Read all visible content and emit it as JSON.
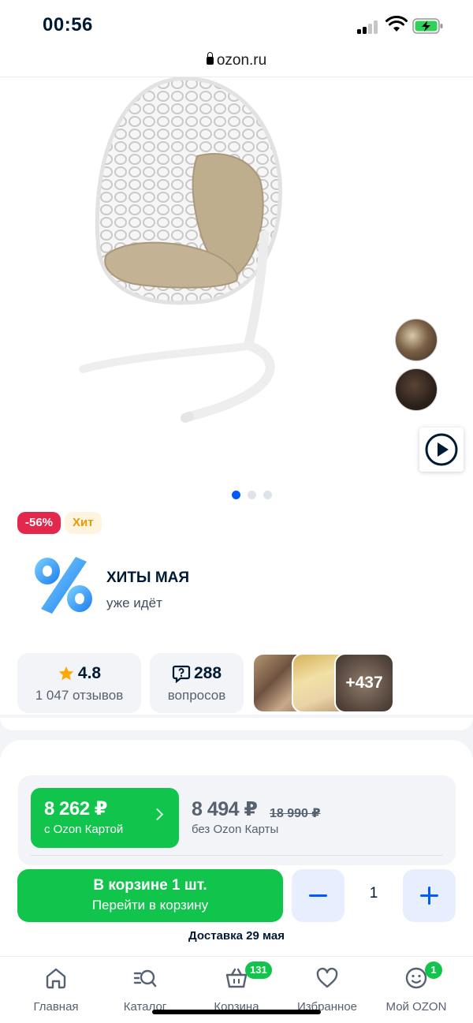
{
  "status_bar": {
    "time": "00:56"
  },
  "browser": {
    "url": "ozon.ru"
  },
  "gallery": {
    "dots_count": 3,
    "active_dot": 0
  },
  "badges": {
    "discount": "-56%",
    "hit": "Хит"
  },
  "promo": {
    "title": "ХИТЫ МАЯ",
    "subtitle": "уже идёт"
  },
  "stats": {
    "rating": "4.8",
    "reviews": "1 047 отзывов",
    "questions_count": "288",
    "questions_label": "вопросов",
    "photos_more": "+437"
  },
  "price": {
    "ozon_card_price": "8 262 ₽",
    "ozon_card_label": "с Ozon Картой",
    "regular_price": "8 494 ₽",
    "old_price": "18 990 ₽",
    "regular_label": "без Ozon Карты"
  },
  "cart": {
    "button_title": "В корзине 1 шт.",
    "button_subtitle": "Перейти в корзину",
    "quantity": "1"
  },
  "delivery": {
    "label": "Доставка",
    "date": "29 мая"
  },
  "tabbar": {
    "items": [
      {
        "label": "Главная",
        "icon": "home-icon"
      },
      {
        "label": "Каталог",
        "icon": "catalog-search-icon"
      },
      {
        "label": "Корзина",
        "icon": "basket-icon",
        "badge": "131"
      },
      {
        "label": "Избранное",
        "icon": "heart-icon"
      },
      {
        "label": "Мой OZON",
        "icon": "profile-smile-icon",
        "badge": "1"
      }
    ]
  },
  "colors": {
    "brand_green": "#10c44c",
    "brand_blue": "#005bff",
    "discount_red": "#e3284d",
    "hit_orange": "#ea9a00"
  }
}
